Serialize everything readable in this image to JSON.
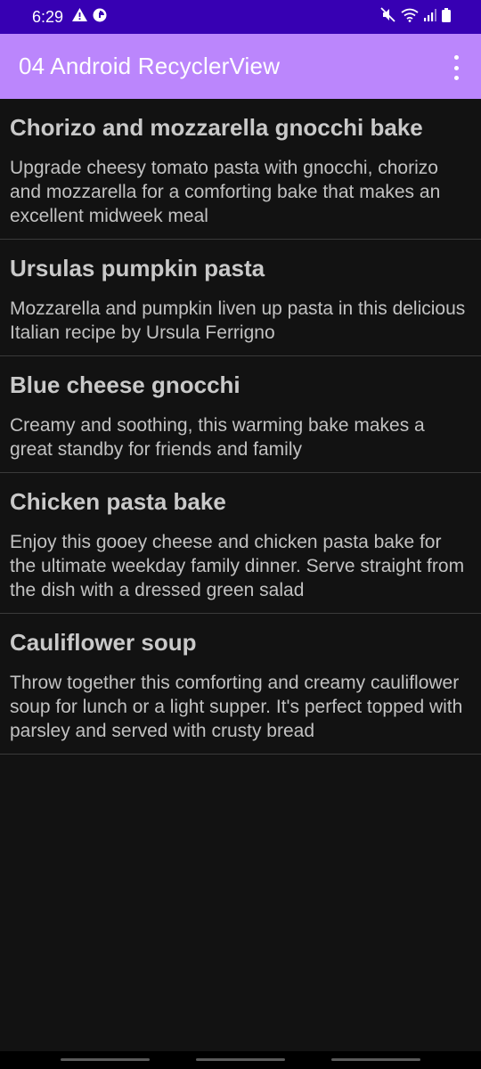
{
  "status_bar": {
    "time": "6:29",
    "left_icons": [
      "alert-triangle-icon",
      "data-saver-icon"
    ],
    "right_icons": [
      "mute-icon",
      "wifi-icon",
      "signal-icon",
      "battery-icon"
    ]
  },
  "app_bar": {
    "title": "04 Android RecyclerView",
    "menu_icon": "more-vert-icon"
  },
  "recipes": [
    {
      "title": "Chorizo and mozzarella gnocchi bake",
      "description": "Upgrade cheesy tomato pasta with gnocchi, chorizo and mozzarella for a comforting bake that makes an excellent midweek meal"
    },
    {
      "title": "Ursulas pumpkin pasta",
      "description": "Mozzarella and pumpkin liven up pasta in this delicious Italian recipe by Ursula Ferrigno"
    },
    {
      "title": "Blue cheese gnocchi",
      "description": "Creamy and soothing, this warming bake makes a great standby for friends and family"
    },
    {
      "title": "Chicken pasta bake",
      "description": "Enjoy this gooey cheese and chicken pasta bake for the ultimate weekday family dinner. Serve straight from the dish with a dressed green salad"
    },
    {
      "title": "Cauliflower soup",
      "description": "Throw together this comforting and creamy cauliflower soup for lunch or a light supper. It's perfect topped with parsley and served with crusty bread"
    }
  ],
  "colors": {
    "status_bar": "#3700b3",
    "app_bar": "#bb86fc",
    "background": "#121212",
    "divider": "#3a3a3a"
  }
}
